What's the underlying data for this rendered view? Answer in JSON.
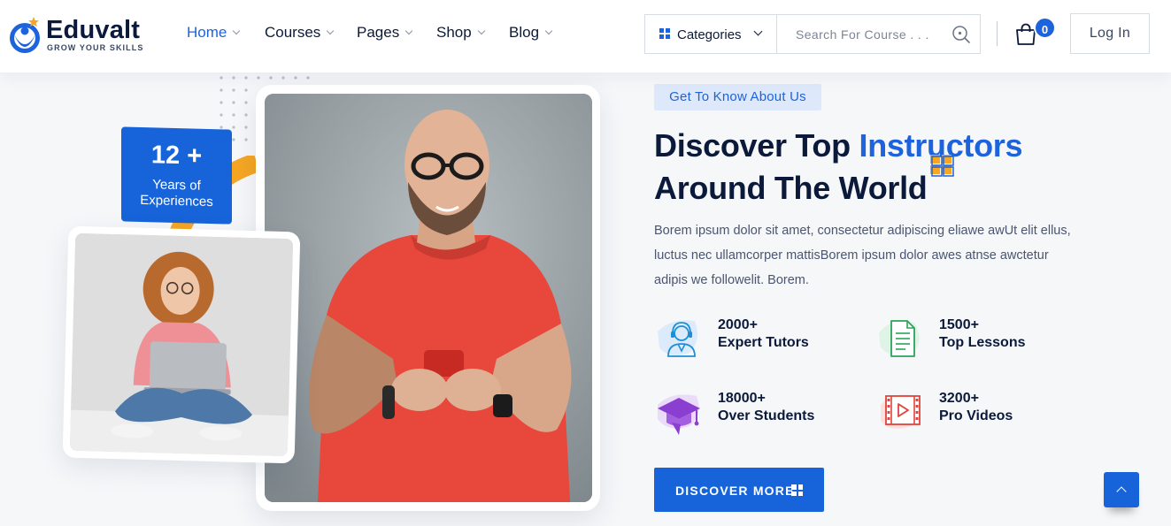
{
  "brand": {
    "name": "Eduvalt",
    "tagline": "GROW YOUR SKILLS"
  },
  "nav": {
    "items": [
      {
        "label": "Home",
        "active": true
      },
      {
        "label": "Courses",
        "active": false
      },
      {
        "label": "Pages",
        "active": false
      },
      {
        "label": "Shop",
        "active": false
      },
      {
        "label": "Blog",
        "active": false
      }
    ]
  },
  "header": {
    "categories_label": "Categories",
    "search_placeholder": "Search For Course . . .",
    "cart_count": "0",
    "login_label": "Log In"
  },
  "hero": {
    "experience": {
      "number": "12 +",
      "line1": "Years of",
      "line2": "Experiences"
    },
    "kicker": "Get To Know About Us",
    "title_part1": "Discover Top ",
    "title_highlight": "Instructors",
    "title_part2": "Around The World",
    "lead": "Borem ipsum dolor sit amet, consectetur adipiscing eliawe awUt elit ellus, luctus nec ullamcorper mattisBorem ipsum dolor awes atnse awctetur adipis we followelit. Borem.",
    "stats": [
      {
        "number": "2000+",
        "label": "Expert Tutors",
        "icon": "tutor-headset-icon"
      },
      {
        "number": "1500+",
        "label": "Top Lessons",
        "icon": "lesson-document-icon"
      },
      {
        "number": "18000+",
        "label": "Over Students",
        "icon": "graduation-cap-icon"
      },
      {
        "number": "3200+",
        "label": "Pro Videos",
        "icon": "video-play-icon"
      }
    ],
    "cta_label": "DISCOVER MORE"
  },
  "colors": {
    "primary": "#1764da",
    "accent_yellow": "#f5a623",
    "text_dark": "#0b1a3a",
    "cta_bg": "#1764da"
  }
}
